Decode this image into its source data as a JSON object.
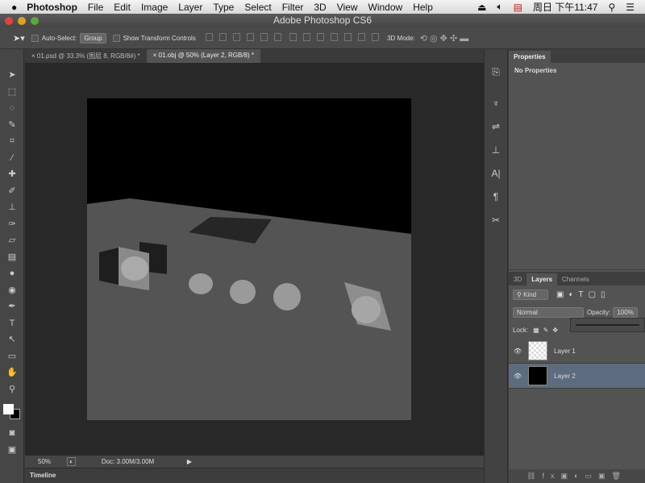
{
  "menubar": {
    "app": "Photoshop",
    "items": [
      "File",
      "Edit",
      "Image",
      "Layer",
      "Type",
      "Select",
      "Filter",
      "3D",
      "View",
      "Window",
      "Help"
    ],
    "clock": "周日 下午11:47"
  },
  "window": {
    "title": "Adobe Photoshop CS6"
  },
  "options": {
    "auto_select": "Auto-Select:",
    "auto_select_value": "Group",
    "show_transform": "Show Transform Controls",
    "mode_3d": "3D Mode:"
  },
  "doc_tabs": [
    {
      "label": "01.psd @ 33.3% (图层 8, RGB/8#) *",
      "active": false
    },
    {
      "label": "01.obj @ 50% (Layer 2, RGB/8) *",
      "active": true
    }
  ],
  "status": {
    "zoom": "50%",
    "doc": "Doc: 3.00M/3.00M"
  },
  "timeline": {
    "label": "Timeline"
  },
  "properties": {
    "tab": "Properties",
    "content": "No Properties"
  },
  "layers_panel": {
    "tabs": [
      "3D",
      "Layers",
      "Channels"
    ],
    "filter": "Kind",
    "blend_mode": "Normal",
    "opacity_label": "Opacity:",
    "opacity": "100%",
    "lock_label": "Lock:",
    "layers": [
      {
        "name": "Layer 1",
        "visible": true,
        "selected": false
      },
      {
        "name": "Layer 2",
        "visible": true,
        "selected": true
      }
    ]
  },
  "colors": {
    "selected_layer": "#5d6b7e",
    "canvas_bg": "#282828",
    "panel": "#535353"
  }
}
